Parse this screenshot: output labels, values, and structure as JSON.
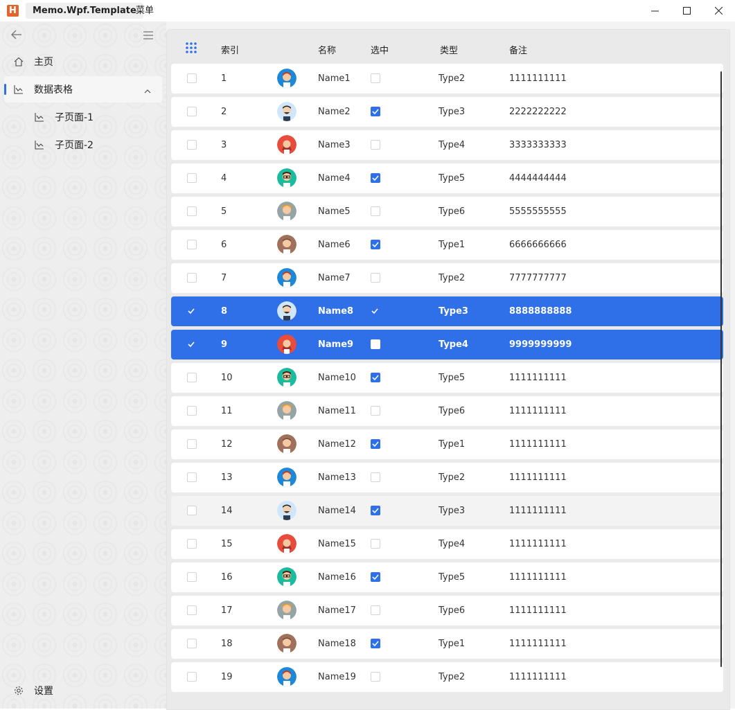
{
  "titlebar": {
    "logo_letter": "H",
    "app_title": "Memo.Wpf.Template",
    "menu_label": "菜单",
    "icons": [
      "minimize-icon",
      "maximize-icon",
      "close-icon"
    ]
  },
  "sidebar": {
    "icons": [
      "back-arrow-icon",
      "hamburger-icon"
    ],
    "items": [
      {
        "label": "主页",
        "icon": "home-icon"
      },
      {
        "label": "数据表格",
        "icon": "chart-icon",
        "expanded": true
      },
      {
        "label": "子页面-1",
        "icon": "chart-icon"
      },
      {
        "label": "子页面-2",
        "icon": "chart-icon"
      }
    ],
    "settings_label": "设置",
    "accent": "#2f6fe8"
  },
  "table": {
    "columns": {
      "index": "索引",
      "name": "名称",
      "checked": "选中",
      "type": "类型",
      "remark": "备注"
    },
    "header_icon": "grid-dots-icon",
    "rows": [
      {
        "index": "1",
        "name": "Name1",
        "checked": false,
        "type": "Type2",
        "remark": "1111111111",
        "selected": false,
        "avatar": "boy-red-hair"
      },
      {
        "index": "2",
        "name": "Name2",
        "checked": true,
        "type": "Type3",
        "remark": "2222222222",
        "selected": false,
        "avatar": "man-beard"
      },
      {
        "index": "3",
        "name": "Name3",
        "checked": false,
        "type": "Type4",
        "remark": "3333333333",
        "selected": false,
        "avatar": "girl-red"
      },
      {
        "index": "4",
        "name": "Name4",
        "checked": true,
        "type": "Type5",
        "remark": "4444444444",
        "selected": false,
        "avatar": "man-glasses"
      },
      {
        "index": "5",
        "name": "Name5",
        "checked": false,
        "type": "Type6",
        "remark": "5555555555",
        "selected": false,
        "avatar": "boy-blonde"
      },
      {
        "index": "6",
        "name": "Name6",
        "checked": true,
        "type": "Type1",
        "remark": "6666666666",
        "selected": false,
        "avatar": "man-brown"
      },
      {
        "index": "7",
        "name": "Name7",
        "checked": false,
        "type": "Type2",
        "remark": "7777777777",
        "selected": false,
        "avatar": "boy-red-hair"
      },
      {
        "index": "8",
        "name": "Name8",
        "checked": true,
        "type": "Type3",
        "remark": "8888888888",
        "selected": true,
        "avatar": "man-beard"
      },
      {
        "index": "9",
        "name": "Name9",
        "checked": false,
        "type": "Type4",
        "remark": "9999999999",
        "selected": true,
        "avatar": "girl-red"
      },
      {
        "index": "10",
        "name": "Name10",
        "checked": true,
        "type": "Type5",
        "remark": "1111111111",
        "selected": false,
        "avatar": "man-glasses"
      },
      {
        "index": "11",
        "name": "Name11",
        "checked": false,
        "type": "Type6",
        "remark": "1111111111",
        "selected": false,
        "avatar": "boy-blonde"
      },
      {
        "index": "12",
        "name": "Name12",
        "checked": true,
        "type": "Type1",
        "remark": "1111111111",
        "selected": false,
        "avatar": "man-brown"
      },
      {
        "index": "13",
        "name": "Name13",
        "checked": false,
        "type": "Type2",
        "remark": "1111111111",
        "selected": false,
        "avatar": "boy-red-hair"
      },
      {
        "index": "14",
        "name": "Name14",
        "checked": true,
        "type": "Type3",
        "remark": "1111111111",
        "selected": false,
        "hover": true,
        "avatar": "man-beard"
      },
      {
        "index": "15",
        "name": "Name15",
        "checked": false,
        "type": "Type4",
        "remark": "1111111111",
        "selected": false,
        "avatar": "girl-red"
      },
      {
        "index": "16",
        "name": "Name16",
        "checked": true,
        "type": "Type5",
        "remark": "1111111111",
        "selected": false,
        "avatar": "man-glasses"
      },
      {
        "index": "17",
        "name": "Name17",
        "checked": false,
        "type": "Type6",
        "remark": "1111111111",
        "selected": false,
        "avatar": "boy-blonde"
      },
      {
        "index": "18",
        "name": "Name18",
        "checked": true,
        "type": "Type1",
        "remark": "1111111111",
        "selected": false,
        "avatar": "man-brown"
      },
      {
        "index": "19",
        "name": "Name19",
        "checked": false,
        "type": "Type2",
        "remark": "1111111111",
        "selected": false,
        "avatar": "boy-red-hair"
      }
    ],
    "selection_color": "#2f6fe8"
  }
}
